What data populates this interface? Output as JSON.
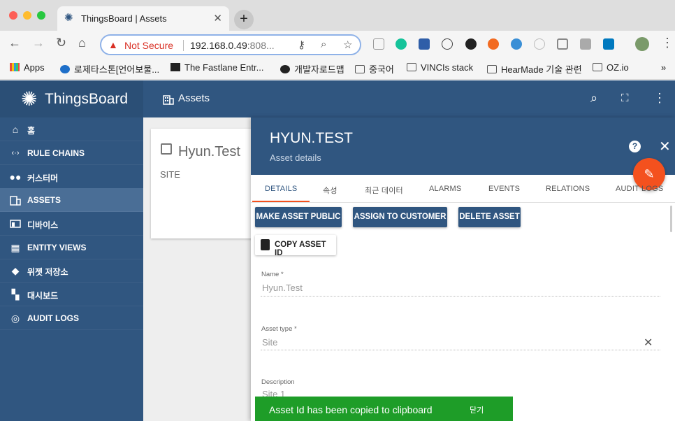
{
  "browser": {
    "tab_title": "ThingsBoard | Assets",
    "new_tab": "+",
    "not_secure": "Not Secure",
    "url_host": "192.168.0.49",
    "url_rest": ":808...",
    "bookmarks": [
      {
        "label": "Apps"
      },
      {
        "label": "로제타스톤[언어보물..."
      },
      {
        "label": "The Fastlane Entr..."
      },
      {
        "label": "개발자로드맵"
      },
      {
        "label": "중국어"
      },
      {
        "label": "VINCIs stack"
      },
      {
        "label": "HearMade 기술 관련"
      },
      {
        "label": "OZ.io"
      }
    ],
    "more_bookmarks": "»"
  },
  "app": {
    "logo_text": "ThingsBoard",
    "page_title": "Assets"
  },
  "sidebar": {
    "items": [
      {
        "label": "홈",
        "icon": "home-icon"
      },
      {
        "label": "RULE CHAINS",
        "icon": "rule-chains-icon"
      },
      {
        "label": "커스터머",
        "icon": "customers-icon"
      },
      {
        "label": "ASSETS",
        "icon": "assets-icon"
      },
      {
        "label": "디바이스",
        "icon": "devices-icon"
      },
      {
        "label": "ENTITY VIEWS",
        "icon": "entity-views-icon"
      },
      {
        "label": "위젯 저장소",
        "icon": "widgets-icon"
      },
      {
        "label": "대시보드",
        "icon": "dashboards-icon"
      },
      {
        "label": "AUDIT LOGS",
        "icon": "audit-logs-icon"
      }
    ]
  },
  "card": {
    "title": "Hyun.Test",
    "type": "SITE"
  },
  "details": {
    "title": "HYUN.TEST",
    "subtitle": "Asset details",
    "tabs": [
      "DETAILS",
      "속성",
      "최근 데이터",
      "ALARMS",
      "EVENTS",
      "RELATIONS",
      "AUDIT LOGS"
    ],
    "buttons": {
      "make_public": "MAKE ASSET PUBLIC",
      "assign": "ASSIGN TO CUSTOMER",
      "delete": "DELETE ASSET",
      "copy_id": "COPY ASSET ID"
    },
    "fields": {
      "name_label": "Name *",
      "name_value": "Hyun.Test",
      "type_label": "Asset type *",
      "type_value": "Site",
      "desc_label": "Description",
      "desc_value": "Site 1"
    }
  },
  "toast": {
    "message": "Asset Id has been copied to clipboard",
    "action": "닫기"
  },
  "colors": {
    "primary": "#305680",
    "accent": "#f4511e",
    "toast": "#1e9d28"
  }
}
